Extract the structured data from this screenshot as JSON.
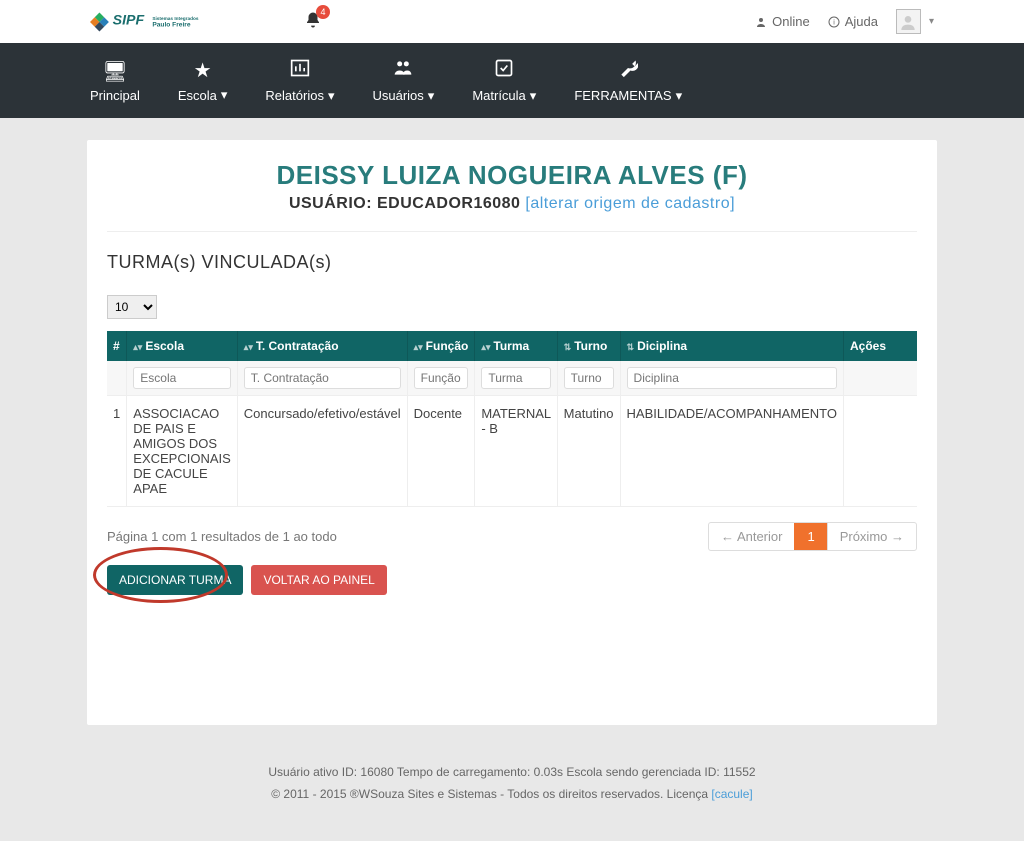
{
  "header": {
    "notifications": "4",
    "online": "Online",
    "help": "Ajuda"
  },
  "nav": {
    "principal": "Principal",
    "escola": "Escola",
    "relatorios": "Relatórios",
    "usuarios": "Usuários",
    "matricula": "Matrícula",
    "ferramentas": "FERRAMENTAS"
  },
  "page": {
    "title": "DEISSY LUIZA NOGUEIRA ALVES (F)",
    "user_label": "USUÁRIO: EDUCADOR16080 ",
    "alter_link": "[alterar origem de cadastro]",
    "section": "TURMA(s) VINCULADA(s)"
  },
  "pagesize": {
    "value": "10"
  },
  "columns": {
    "idx": "#",
    "escola": "Escola",
    "contratacao": "T. Contratação",
    "funcao": "Função",
    "turma": "Turma",
    "turno": "Turno",
    "diciplina": "Diciplina",
    "acoes": "Ações"
  },
  "filters": {
    "escola_ph": "Escola",
    "contratacao_ph": "T. Contratação",
    "funcao_ph": "Função",
    "turma_ph": "Turma",
    "turno_ph": "Turno",
    "diciplina_ph": "Diciplina"
  },
  "row": {
    "idx": "1",
    "escola": "ASSOCIACAO DE PAIS E AMIGOS DOS EXCEPCIONAIS DE CACULE APAE",
    "contratacao": "Concursado/efetivo/estável",
    "funcao": "Docente",
    "turma": "MATERNAL - B",
    "turno": "Matutino",
    "diciplina": "HABILIDADE/ACOMPANHAMENTO"
  },
  "pager": {
    "info": "Página 1 com 1 resultados de 1 ao todo",
    "prev": "← Anterior",
    "page": "1",
    "next": "Próximo →"
  },
  "buttons": {
    "add": "ADICIONAR TURMA",
    "back": "VOLTAR AO PAINEL"
  },
  "footer": {
    "line1": "Usuário ativo ID: 16080 Tempo de carregamento: 0.03s Escola sendo gerenciada ID: 11552",
    "line2a": "© 2011 - 2015 ®WSouza Sites e Sistemas - Todos os direitos reservados. Licença ",
    "line2b": "[cacule]"
  }
}
